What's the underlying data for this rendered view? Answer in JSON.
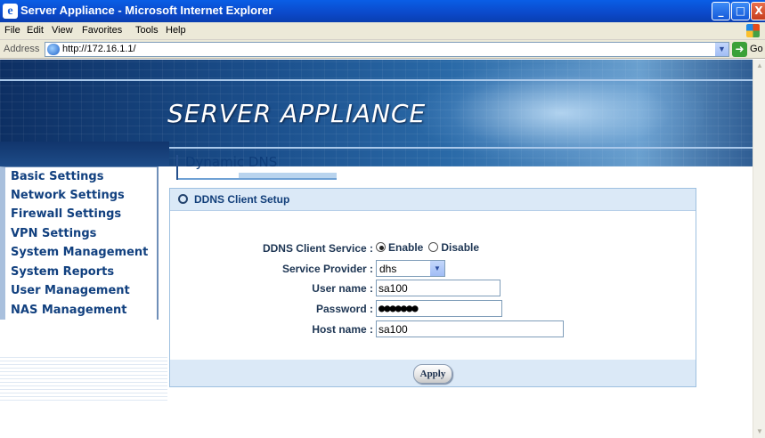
{
  "window": {
    "title": "Server Appliance - Microsoft Internet Explorer",
    "minimize": "_",
    "maximize": "□",
    "close": "X"
  },
  "menubar": {
    "items": [
      "File",
      "Edit",
      "View",
      "Favorites",
      "Tools",
      "Help"
    ]
  },
  "addressbar": {
    "label": "Address",
    "url": "http://172.16.1.1/",
    "go_label": "Go"
  },
  "banner": {
    "title": "SERVER APPLIANCE"
  },
  "sidebar": {
    "items": [
      "Basic Settings",
      "Network Settings",
      "Firewall Settings",
      "VPN Settings",
      "System Management",
      "System Reports",
      "User Management",
      "NAS Management"
    ]
  },
  "page": {
    "title": "Dynamic DNS",
    "section_title": "DDNS Client Setup"
  },
  "form": {
    "service_label": "DDNS Client Service :",
    "enable_label": "Enable",
    "disable_label": "Disable",
    "service_enabled": true,
    "provider_label": "Service Provider :",
    "provider_value": "dhs",
    "username_label": "User name :",
    "username_value": "sa100",
    "password_label": "Password :",
    "password_value": "●●●●●●●",
    "hostname_label": "Host name :",
    "hostname_value": "sa100",
    "apply_label": "Apply"
  },
  "icons": {
    "ie": "internet-explorer-icon",
    "windows_flag": "windows-flag-icon",
    "page": "page-icon",
    "go": "go-arrow-icon"
  }
}
